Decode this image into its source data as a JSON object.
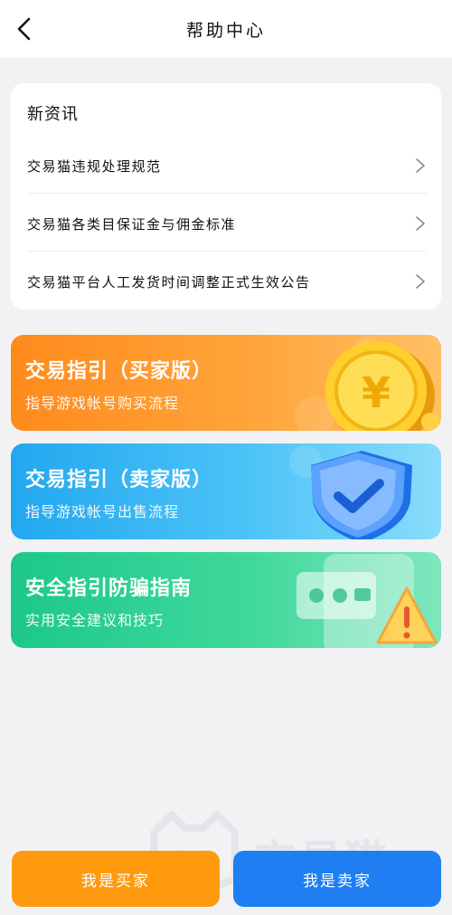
{
  "header": {
    "title": "帮助中心"
  },
  "news": {
    "heading": "新资讯",
    "items": [
      {
        "label": "交易猫违规处理规范"
      },
      {
        "label": "交易猫各类目保证金与佣金标准"
      },
      {
        "label": "交易猫平台人工发货时间调整正式生效公告"
      }
    ]
  },
  "guides": [
    {
      "title": "交易指引（买家版）",
      "subtitle": "指导游戏帐号购买流程",
      "color": "#ff8a1c",
      "icon": "gold-coin-icon"
    },
    {
      "title": "交易指引（卖家版）",
      "subtitle": "指导游戏帐号出售流程",
      "color": "#22a7ef",
      "icon": "shield-check-icon"
    },
    {
      "title": "安全指引防骗指南",
      "subtitle": "实用安全建议和技巧",
      "color": "#1dc88a",
      "icon": "phone-warning-icon"
    }
  ],
  "watermark": {
    "text": "交易猫"
  },
  "bottom": {
    "buyer_label": "我是买家",
    "seller_label": "我是卖家",
    "buyer_color": "#ff9a0f",
    "seller_color": "#1f7ff2"
  }
}
